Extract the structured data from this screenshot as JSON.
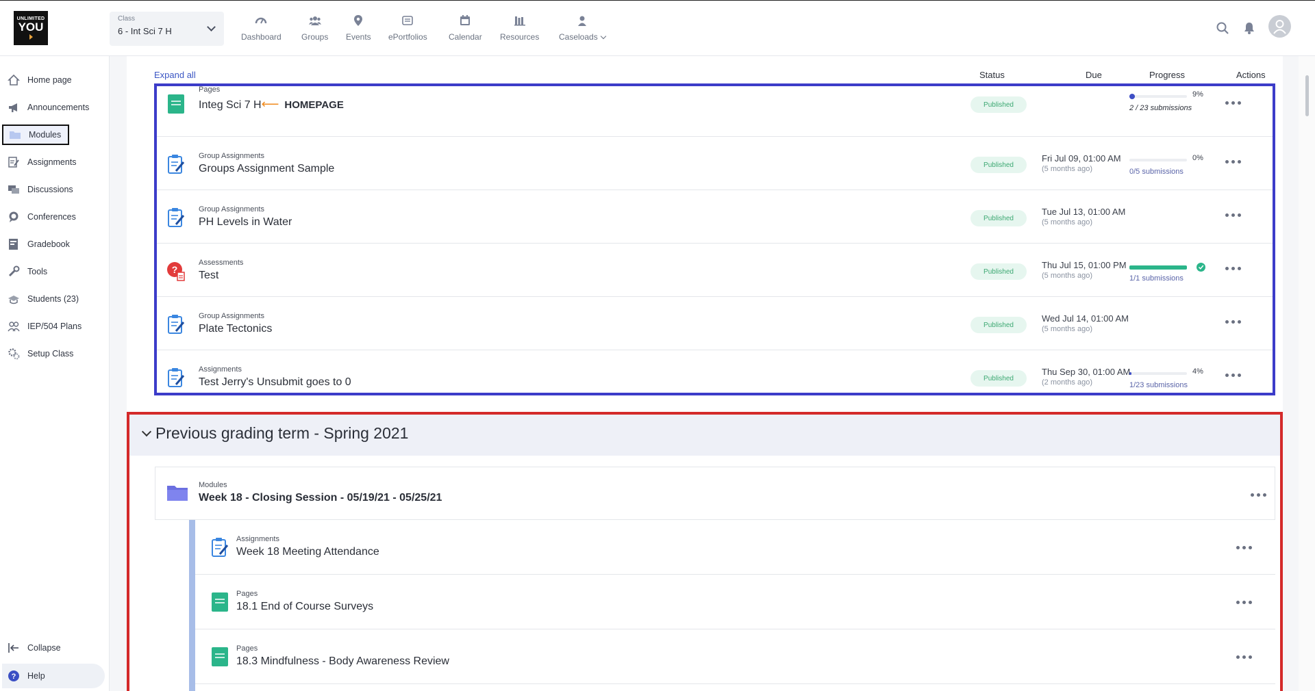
{
  "header": {
    "logo_text": [
      "UNLIMITED",
      "YOU"
    ],
    "class_label": "Class",
    "class_value": "6 - Int Sci 7 H",
    "nav": [
      {
        "label": "Dashboard",
        "icon": "gauge-icon"
      },
      {
        "label": "Groups",
        "icon": "people-icon"
      },
      {
        "label": "Events",
        "icon": "map-pin-icon"
      },
      {
        "label": "ePortfolios",
        "icon": "portfolio-icon"
      },
      {
        "label": "Calendar",
        "icon": "calendar-icon"
      },
      {
        "label": "Resources",
        "icon": "books-icon"
      },
      {
        "label": "Caseloads",
        "icon": "person-icon"
      }
    ]
  },
  "sidebar": {
    "items": [
      {
        "label": "Home page",
        "icon": "home-icon"
      },
      {
        "label": "Announcements",
        "icon": "megaphone-icon"
      },
      {
        "label": "Modules",
        "icon": "folder-icon"
      },
      {
        "label": "Assignments",
        "icon": "assignment-icon"
      },
      {
        "label": "Discussions",
        "icon": "discussion-icon"
      },
      {
        "label": "Conferences",
        "icon": "chat-bubble-icon"
      },
      {
        "label": "Gradebook",
        "icon": "gradebook-icon"
      },
      {
        "label": "Tools",
        "icon": "tools-icon"
      },
      {
        "label": "Students (23)",
        "icon": "students-icon"
      },
      {
        "label": "IEP/504 Plans",
        "icon": "group-icon"
      },
      {
        "label": "Setup Class",
        "icon": "gears-icon"
      }
    ],
    "collapse": "Collapse",
    "help": "Help"
  },
  "main": {
    "expand_all": "Expand all",
    "columns": {
      "status": "Status",
      "due": "Due",
      "progress": "Progress",
      "actions": "Actions"
    },
    "rows": [
      {
        "type": "Pages",
        "title": "Integ Sci 7 H",
        "annotation": "HOMEPAGE",
        "status": "Published",
        "due": "",
        "due_ago": "",
        "progress_pct": "9%",
        "progress": 0.09,
        "submissions": "2 / 23 submissions",
        "icon": "page-icon"
      },
      {
        "type": "Group Assignments",
        "title": "Groups Assignment Sample",
        "status": "Published",
        "due": "Fri Jul 09, 01:00 AM",
        "due_ago": "(5 months ago)",
        "progress_pct": "0%",
        "progress": 0,
        "submissions": "0/5 submissions",
        "icon": "assignment-icon"
      },
      {
        "type": "Group Assignments",
        "title": "PH Levels in Water",
        "status": "Published",
        "due": "Tue Jul 13, 01:00 AM",
        "due_ago": "(5 months ago)",
        "progress_pct": "",
        "progress": null,
        "submissions": "",
        "icon": "assignment-icon"
      },
      {
        "type": "Assessments",
        "title": "Test",
        "status": "Published",
        "due": "Thu Jul 15, 01:00 PM",
        "due_ago": "(5 months ago)",
        "progress_pct": "",
        "progress": 1,
        "submissions": "1/1 submissions",
        "icon": "assessment-icon"
      },
      {
        "type": "Group Assignments",
        "title": "Plate Tectonics",
        "status": "Published",
        "due": "Wed Jul 14, 01:00 AM",
        "due_ago": "(5 months ago)",
        "progress_pct": "",
        "progress": null,
        "submissions": "",
        "icon": "assignment-icon"
      },
      {
        "type": "Assignments",
        "title": "Test Jerry's Unsubmit goes to 0",
        "status": "Published",
        "due": "Thu Sep 30, 01:00 AM",
        "due_ago": "(2 months ago)",
        "progress_pct": "4%",
        "progress": 0.04,
        "submissions": "1/23 submissions",
        "icon": "assignment-icon"
      }
    ],
    "term": {
      "title": "Previous grading term - Spring 2021",
      "module": {
        "type": "Modules",
        "title": "Week 18 - Closing Session - 05/19/21 - 05/25/21"
      },
      "items": [
        {
          "type": "Assignments",
          "title": "Week 18 Meeting Attendance",
          "icon": "assignment-icon"
        },
        {
          "type": "Pages",
          "title": "18.1 End of Course Surveys",
          "icon": "page-icon"
        },
        {
          "type": "Pages",
          "title": "18.3 Mindfulness - Body Awareness Review",
          "icon": "page-icon"
        }
      ]
    }
  },
  "colors": {
    "accent": "#3c3cc9",
    "highlight_red": "#d42a2a",
    "published_bg": "#e6f6ef",
    "published_text": "#3ca872",
    "progress_fill": "#3f4fc5",
    "complete_fill": "#2bb58a",
    "annotation_arrow": "#f08a1c"
  }
}
